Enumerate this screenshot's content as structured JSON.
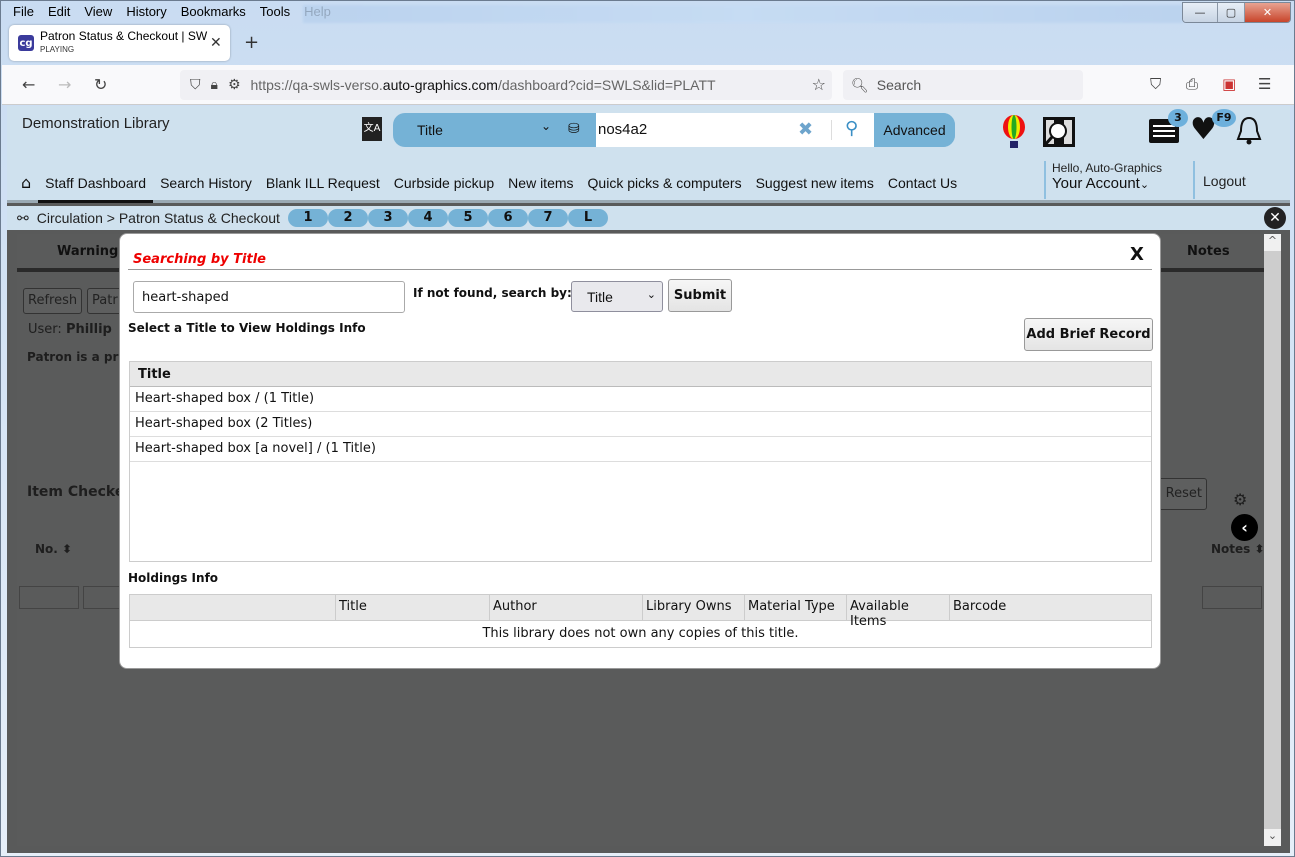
{
  "browser": {
    "menu": [
      "File",
      "Edit",
      "View",
      "History",
      "Bookmarks",
      "Tools",
      "Help"
    ],
    "tab": {
      "title": "Patron Status & Checkout | SWLS",
      "subtitle": "PLAYING"
    },
    "url_prefix": "https://qa-swls-verso.",
    "url_domain": "auto-graphics.com",
    "url_suffix": "/dashboard?cid=SWLS&lid=PLATT",
    "search_placeholder": "Search",
    "window_controls": {
      "minimize": "—",
      "maximize": "▢",
      "close": "✕"
    }
  },
  "header": {
    "library_name": "Demonstration Library",
    "search_type": "Title",
    "search_value": "nos4a2",
    "advanced_label": "Advanced",
    "list_badge": "3",
    "favorites_badge": "F9",
    "greeting": "Hello, Auto-Graphics",
    "account_label": "Your Account",
    "logout_label": "Logout"
  },
  "nav": {
    "items": [
      "Staff Dashboard",
      "Search History",
      "Blank ILL Request",
      "Curbside pickup",
      "New items",
      "Quick picks & computers",
      "Suggest new items",
      "Contact Us"
    ],
    "active": "Staff Dashboard"
  },
  "breadcrumb": {
    "path": "Circulation > Patron Status & Checkout",
    "pills": [
      "1",
      "2",
      "3",
      "4",
      "5",
      "6",
      "7",
      "L"
    ]
  },
  "background": {
    "tab_warnings": "Warnings",
    "tab_notes": "Notes",
    "refresh_label": "Refresh",
    "patron_btn_partial": "Patr",
    "user_label": "User:",
    "user_name": "Phillip",
    "patron_msg": "Patron is a pr",
    "item_checkout": "Item Checke",
    "reset_label": "Reset",
    "col_no": "No.",
    "col_notes": "Notes"
  },
  "modal": {
    "title": "Searching by Title",
    "close": "X",
    "search_value": "heart-shaped",
    "fallback_label": "If not found, search by:",
    "fallback_option": "Title",
    "submit_label": "Submit",
    "hint": "Select a Title to View Holdings Info",
    "add_brief_label": "Add Brief Record",
    "titles_header": "Title",
    "titles": [
      "Heart-shaped box / (1 Title)",
      "Heart-shaped box (2 Titles)",
      "Heart-shaped box [a novel] / (1 Title)"
    ],
    "holdings_label": "Holdings Info",
    "holdings_columns": [
      "",
      "Title",
      "Author",
      "Library Owns",
      "Material Type",
      "Available Items",
      "Barcode"
    ],
    "holdings_empty": "This library does not own any copies of this title."
  }
}
